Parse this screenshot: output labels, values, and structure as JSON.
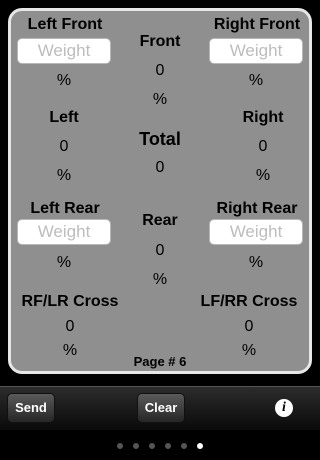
{
  "left_front": {
    "label": "Left Front",
    "placeholder": "Weight",
    "percent": "%"
  },
  "right_front": {
    "label": "Right Front",
    "placeholder": "Weight",
    "percent": "%"
  },
  "front": {
    "label": "Front",
    "value": "0",
    "percent": "%"
  },
  "left": {
    "label": "Left",
    "value": "0",
    "percent": "%"
  },
  "right": {
    "label": "Right",
    "value": "0",
    "percent": "%"
  },
  "total": {
    "label": "Total",
    "value": "0"
  },
  "left_rear": {
    "label": "Left Rear",
    "placeholder": "Weight",
    "percent": "%"
  },
  "right_rear": {
    "label": "Right Rear",
    "placeholder": "Weight",
    "percent": "%"
  },
  "rear": {
    "label": "Rear",
    "value": "0",
    "percent": "%"
  },
  "rf_lr_cross": {
    "label": "RF/LR Cross",
    "value": "0",
    "percent": "%"
  },
  "lf_rr_cross": {
    "label": "LF/RR Cross",
    "value": "0",
    "percent": "%"
  },
  "page_label": "Page # 6",
  "toolbar": {
    "send_label": "Send",
    "clear_label": "Clear",
    "info_icon": "info-icon",
    "info_glyph": "i"
  },
  "pagination": {
    "count": 6,
    "active_index": 5
  }
}
